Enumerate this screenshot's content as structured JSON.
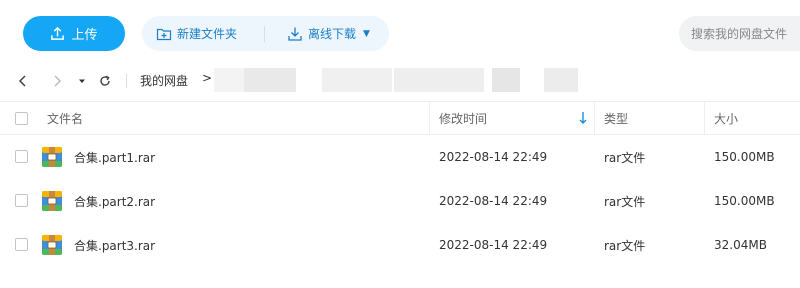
{
  "toolbar": {
    "upload_label": "上传",
    "new_folder_label": "新建文件夹",
    "offline_download_label": "离线下载",
    "search_placeholder": "搜索我的网盘文件"
  },
  "breadcrumb": {
    "root": "我的网盘",
    "separator": ">"
  },
  "table": {
    "headers": {
      "name": "文件名",
      "modified": "修改时间",
      "type": "类型",
      "size": "大小"
    },
    "rows": [
      {
        "name": "合集.part1.rar",
        "modified": "2022-08-14 22:49",
        "type": "rar文件",
        "size": "150.00MB"
      },
      {
        "name": "合集.part2.rar",
        "modified": "2022-08-14 22:49",
        "type": "rar文件",
        "size": "150.00MB"
      },
      {
        "name": "合集.part3.rar",
        "modified": "2022-08-14 22:49",
        "type": "rar文件",
        "size": "32.04MB"
      }
    ]
  },
  "colors": {
    "accent": "#15a7f5",
    "action_text": "#1a7fc9",
    "action_bg": "#eef6fd",
    "sort_arrow": "#1a8fe0"
  },
  "icons": {
    "upload": "upload-icon",
    "new_folder": "new-folder-icon",
    "offline_download": "download-icon",
    "back": "back-arrow-icon",
    "forward": "forward-arrow-icon",
    "history_dropdown": "caret-down-icon",
    "refresh": "refresh-icon",
    "sort": "sort-down-arrow-icon",
    "file": "rar-archive-icon"
  }
}
